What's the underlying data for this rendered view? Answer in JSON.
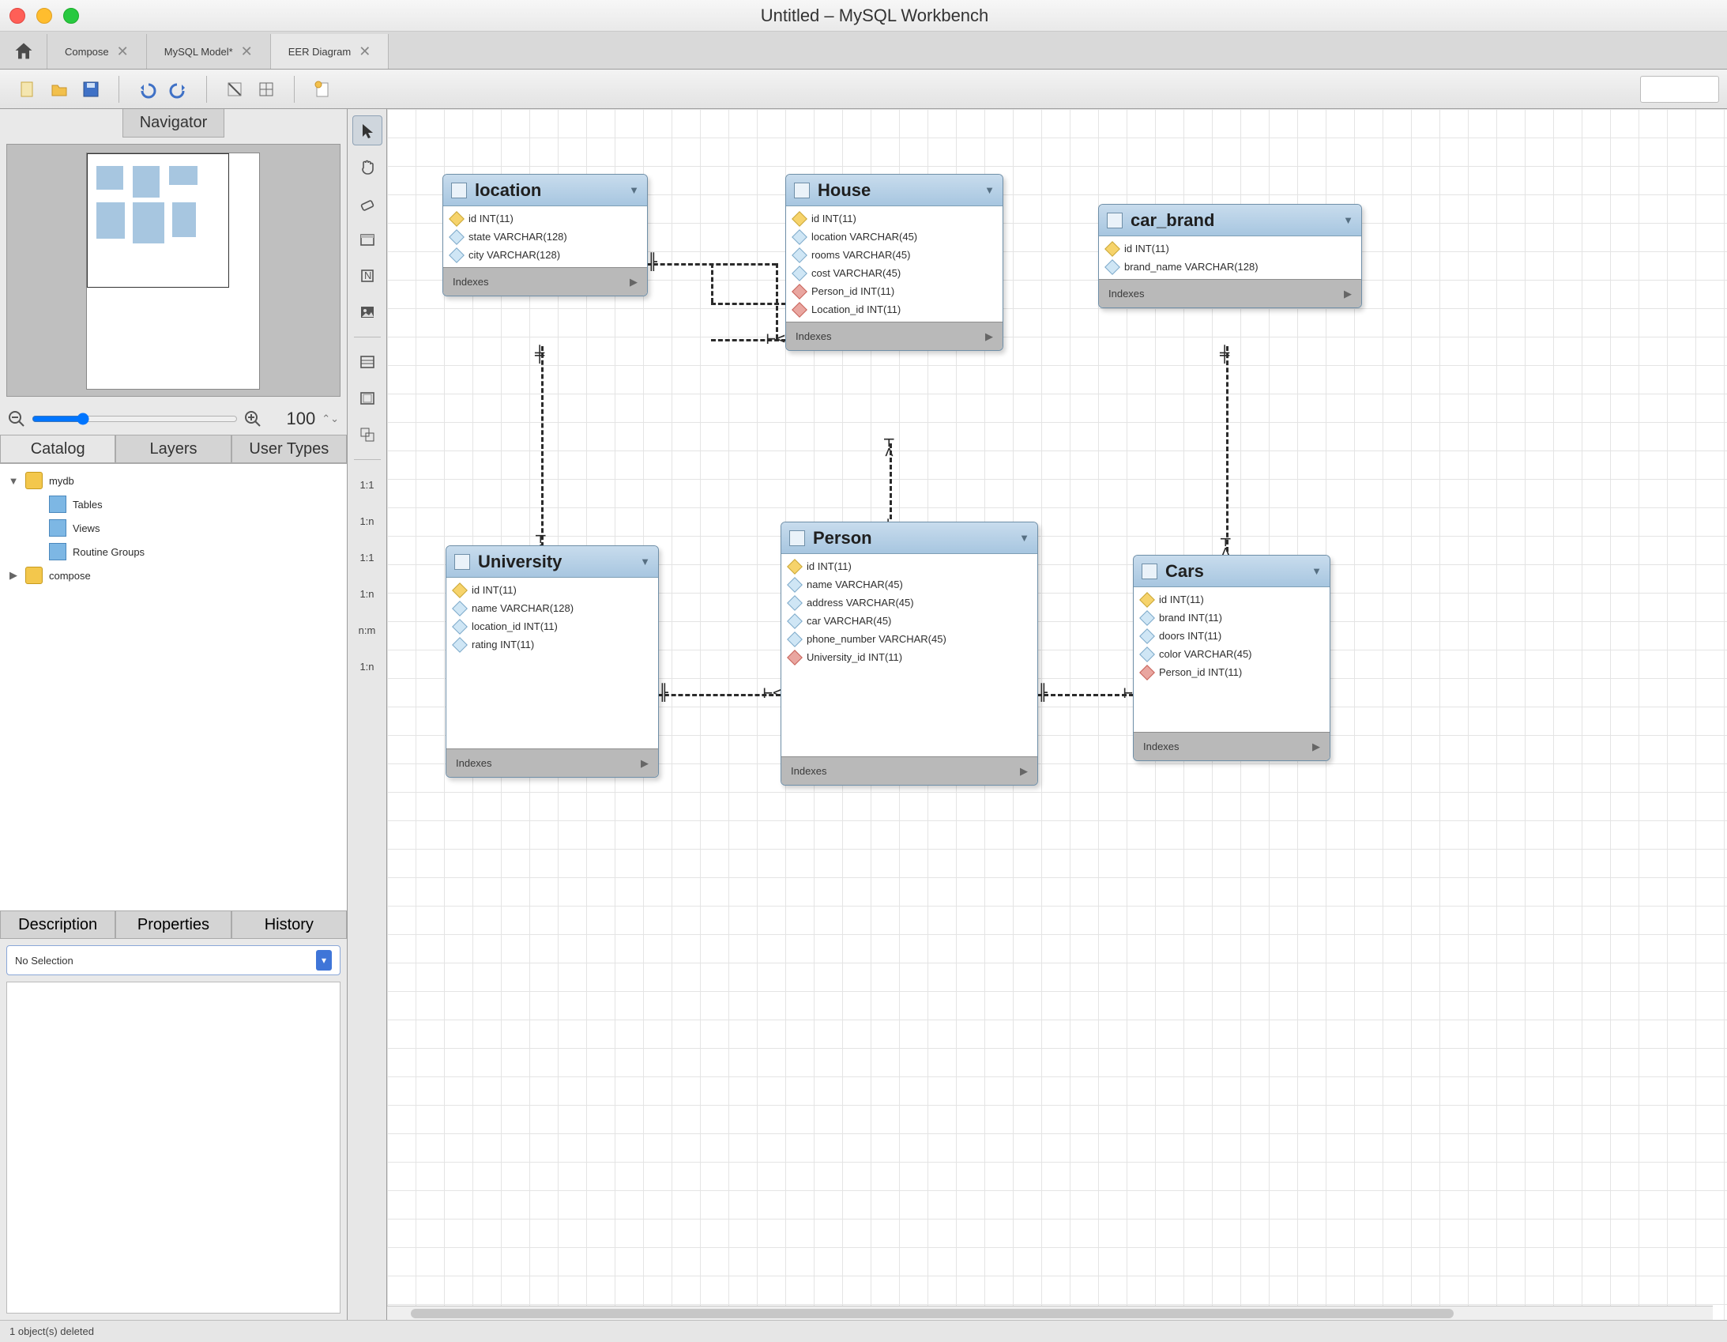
{
  "window_title": "Untitled – MySQL Workbench",
  "tabs": [
    {
      "label": "Compose",
      "closable": true
    },
    {
      "label": "MySQL Model*",
      "closable": true
    },
    {
      "label": "EER Diagram",
      "closable": true,
      "active": true
    }
  ],
  "navigator_tab": "Navigator",
  "zoom_value": "100",
  "catalog_tabs": [
    "Catalog",
    "Layers",
    "User Types"
  ],
  "tree": {
    "dbs": [
      {
        "name": "mydb",
        "expanded": true,
        "children": [
          "Tables",
          "Views",
          "Routine Groups"
        ]
      },
      {
        "name": "compose",
        "expanded": false
      }
    ]
  },
  "info_tabs": [
    "Description",
    "Properties",
    "History"
  ],
  "selector_text": "No Selection",
  "status_text": "1 object(s) deleted",
  "palette_labels": {
    "rel11i": "1:1",
    "rel1ni": "1:n",
    "rel11": "1:1",
    "rel1n": "1:n",
    "relnm": "n:m",
    "rel1nf": "1:n"
  },
  "tables": {
    "location": {
      "name": "location",
      "indexes_label": "Indexes",
      "cols": [
        {
          "k": "pk",
          "t": "id INT(11)"
        },
        {
          "k": "nn",
          "t": "state VARCHAR(128)"
        },
        {
          "k": "nn",
          "t": "city VARCHAR(128)"
        }
      ]
    },
    "house": {
      "name": "House",
      "indexes_label": "Indexes",
      "cols": [
        {
          "k": "pk",
          "t": "id INT(11)"
        },
        {
          "k": "nn",
          "t": "location VARCHAR(45)"
        },
        {
          "k": "nn",
          "t": "rooms VARCHAR(45)"
        },
        {
          "k": "nn",
          "t": "cost VARCHAR(45)"
        },
        {
          "k": "fk",
          "t": "Person_id INT(11)"
        },
        {
          "k": "fk",
          "t": "Location_id INT(11)"
        }
      ]
    },
    "car_brand": {
      "name": "car_brand",
      "indexes_label": "Indexes",
      "cols": [
        {
          "k": "pk",
          "t": "id INT(11)"
        },
        {
          "k": "nn",
          "t": "brand_name VARCHAR(128)"
        }
      ]
    },
    "university": {
      "name": "University",
      "indexes_label": "Indexes",
      "cols": [
        {
          "k": "pk",
          "t": "id INT(11)"
        },
        {
          "k": "nn",
          "t": "name VARCHAR(128)"
        },
        {
          "k": "nn",
          "t": "location_id INT(11)"
        },
        {
          "k": "nn",
          "t": "rating INT(11)"
        }
      ]
    },
    "person": {
      "name": "Person",
      "indexes_label": "Indexes",
      "cols": [
        {
          "k": "pk",
          "t": "id INT(11)"
        },
        {
          "k": "nn",
          "t": "name VARCHAR(45)"
        },
        {
          "k": "nn",
          "t": "address VARCHAR(45)"
        },
        {
          "k": "nn",
          "t": "car VARCHAR(45)"
        },
        {
          "k": "nn",
          "t": "phone_number VARCHAR(45)"
        },
        {
          "k": "fk",
          "t": "University_id INT(11)"
        }
      ]
    },
    "cars": {
      "name": "Cars",
      "indexes_label": "Indexes",
      "cols": [
        {
          "k": "pk",
          "t": "id INT(11)"
        },
        {
          "k": "nn",
          "t": "brand INT(11)"
        },
        {
          "k": "nn",
          "t": "doors INT(11)"
        },
        {
          "k": "nn",
          "t": "color VARCHAR(45)"
        },
        {
          "k": "fk",
          "t": "Person_id INT(11)"
        }
      ]
    }
  }
}
